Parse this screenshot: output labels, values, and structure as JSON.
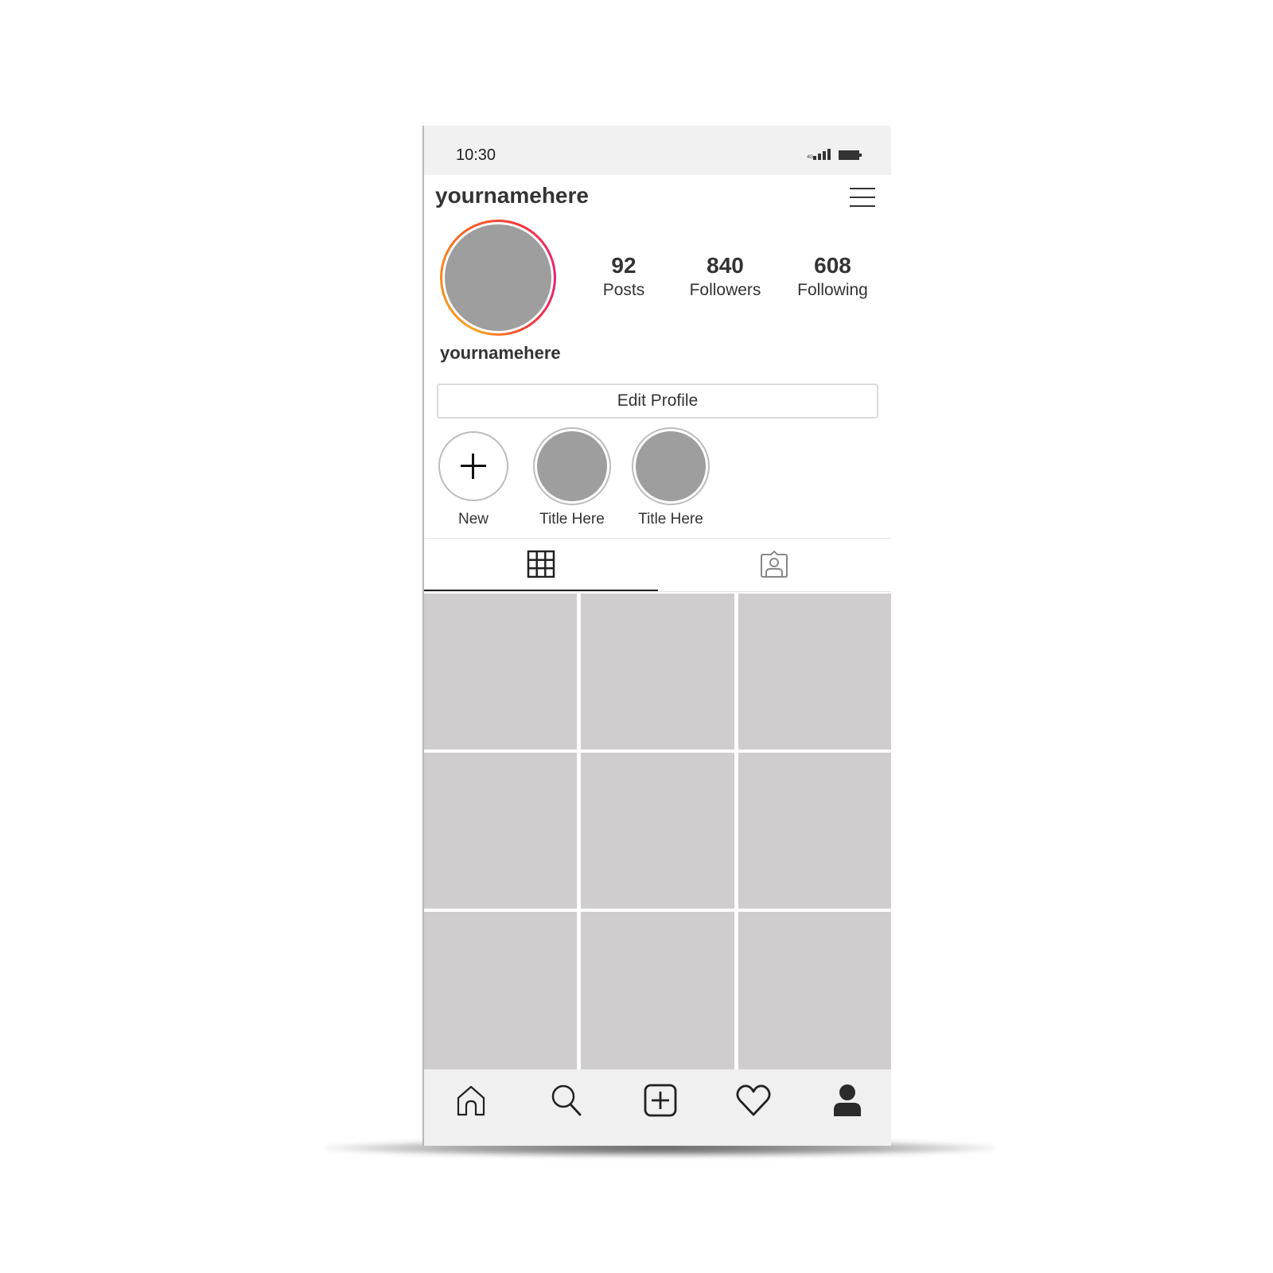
{
  "status_bar": {
    "time": "10:30",
    "network": "4G",
    "signal_icon": "cellular-signal-icon",
    "battery_icon": "battery-icon"
  },
  "header": {
    "username": "yournamehere",
    "menu_icon": "hamburger-menu-icon"
  },
  "profile": {
    "display_name": "yournamehere",
    "stats": [
      {
        "value": "92",
        "label": "Posts"
      },
      {
        "value": "840",
        "label": "Followers"
      },
      {
        "value": "608",
        "label": "Following"
      }
    ],
    "story_ring_colors": [
      "#f9a21f",
      "#f77f21",
      "#f4363a",
      "#e9207a"
    ],
    "edit_profile_label": "Edit Profile"
  },
  "highlights": [
    {
      "title": "New",
      "icon": "plus-icon"
    },
    {
      "title": "Title Here"
    },
    {
      "title": "Title Here"
    }
  ],
  "tabs": [
    {
      "name": "grid",
      "icon": "grid-icon",
      "active": true
    },
    {
      "name": "tagged",
      "icon": "tagged-user-icon",
      "active": false
    }
  ],
  "posts": {
    "count_visible": 9,
    "placeholder_color": "#d0cdce"
  },
  "bottom_nav": [
    {
      "name": "home",
      "icon": "home-icon"
    },
    {
      "name": "search",
      "icon": "search-icon"
    },
    {
      "name": "new-post",
      "icon": "add-post-icon"
    },
    {
      "name": "activity",
      "icon": "heart-icon"
    },
    {
      "name": "profile",
      "icon": "profile-icon",
      "active": true
    }
  ]
}
